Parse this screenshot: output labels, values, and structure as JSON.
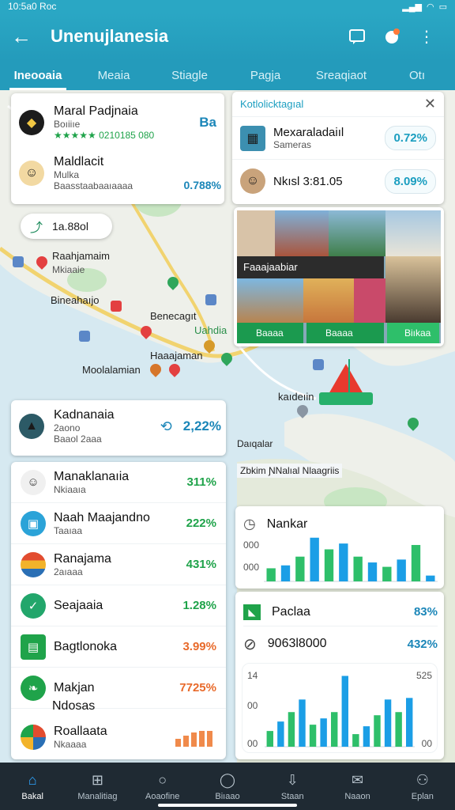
{
  "status": {
    "time": "10:5a0 Roc",
    "icons": [
      "signal-icon",
      "wifi-icon",
      "battery-icon"
    ]
  },
  "app": {
    "title": "Unenujlanesia"
  },
  "tabs": [
    {
      "label": "Ineooaia",
      "active": true
    },
    {
      "label": "Meaia"
    },
    {
      "label": "Stiagle"
    },
    {
      "label": "Pagja"
    },
    {
      "label": "Sreaqiaot"
    },
    {
      "label": "Otı"
    }
  ],
  "map_labels": {
    "a": "Raahjamaim",
    "b": "Mkiaaie",
    "c": "Bineahaıjo",
    "d": "Benecagıt",
    "e": "Uahdia",
    "f": "Haaajaman",
    "g": "Moolalamian",
    "h": "kaıdeıin",
    "i": "Daıqalar",
    "j": "Zbkim ƝNalıal Nlaagriis"
  },
  "top_card": {
    "name1": "Maral Padjnaia",
    "sub1": "Boıiiıe",
    "rating": "★★★★★ 0210185 080",
    "badge1": "Ba",
    "name2": "Maldlacit",
    "sub2": "Mulka",
    "sub2b": "Baasstaabaaıaaaa",
    "pct2": "0.788%"
  },
  "small_pill": {
    "label": "1a.88ol"
  },
  "right_card": {
    "header": "Kotlolicktagıal",
    "rows": [
      {
        "title": "Mexaraladaiıl",
        "sub": "Sameras",
        "value": "0.72%"
      },
      {
        "title": "Nkısl 3:81.05",
        "sub": "",
        "value": "8.09%"
      }
    ]
  },
  "gallery": {
    "label": "Faaajaabiar",
    "tiles": [
      "Baaaa",
      "Baaaa",
      "Biıkaa"
    ]
  },
  "mid_card": {
    "name": "Kadnanaia",
    "sub": "2aono",
    "sub2": "Baaol 2aaa",
    "value": "2,22%"
  },
  "list": [
    {
      "title": "Manaklanaıia",
      "sub": "Nkiaaıa",
      "value": "311%",
      "color": "green",
      "icon": "person-icon"
    },
    {
      "title": "Naah Maajandno",
      "sub": "Taaıaa",
      "value": "222%",
      "color": "green",
      "icon": "cube-icon"
    },
    {
      "title": "Ranajama",
      "sub": "2aıaaa",
      "value": "431%",
      "color": "green",
      "icon": "flag-icon"
    },
    {
      "title": "Seajaaia",
      "sub": "",
      "value": "1.28%",
      "color": "green",
      "icon": "leaf-icon"
    },
    {
      "title": "Bagtlonoka",
      "sub": "",
      "value": "3.99%",
      "color": "orange",
      "icon": "shop-icon"
    },
    {
      "title": "Makjan",
      "sub": "",
      "value": "7725%",
      "color": "orange",
      "icon": "leaf2-icon"
    },
    {
      "title": "Ndosas",
      "sub": "",
      "value": "",
      "color": "green",
      "icon": ""
    },
    {
      "title": "Roallaata",
      "sub": "Nkaaaa",
      "value": "",
      "color": "orange",
      "icon": "badge-icon"
    }
  ],
  "chart1": {
    "title": "Nankar",
    "yticks": [
      "000",
      "000"
    ]
  },
  "chart2": {
    "row1": {
      "title": "Paclaa",
      "value": "83%"
    },
    "row2": {
      "title": "9063l8000",
      "value": "432%"
    },
    "yticks_left": [
      "14",
      "00",
      "00"
    ],
    "yticks_right": [
      "525",
      "00"
    ]
  },
  "chart_data": [
    {
      "type": "bar",
      "title": "Nankar",
      "categories": [
        "1",
        "2",
        "3",
        "4",
        "5",
        "6",
        "7",
        "8",
        "9",
        "10",
        "11",
        "12"
      ],
      "series": [
        {
          "values": [
            18,
            22,
            34,
            60,
            44,
            52,
            34,
            26,
            20,
            30,
            50,
            8
          ]
        }
      ],
      "colors": [
        "#2ebf6a",
        "#1b9ee6"
      ]
    },
    {
      "type": "bar",
      "categories": [
        "1",
        "2",
        "3",
        "4",
        "5",
        "6",
        "7",
        "8",
        "9",
        "10",
        "11",
        "12",
        "13",
        "14"
      ],
      "series": [
        {
          "values": [
            20,
            32,
            44,
            60,
            28,
            36,
            44,
            90,
            16,
            26,
            40,
            60,
            44,
            62
          ]
        }
      ],
      "colors": [
        "#2ebf6a",
        "#1b9ee6"
      ]
    }
  ],
  "bottom_nav": [
    {
      "label": "Bakal",
      "icon": "home-icon",
      "active": true
    },
    {
      "label": "Manalitiag",
      "icon": "grid-icon"
    },
    {
      "label": "Aoaofine",
      "icon": "search-icon"
    },
    {
      "label": "Biıaao",
      "icon": "bell-icon"
    },
    {
      "label": "Staan",
      "icon": "download-icon"
    },
    {
      "label": "Naaon",
      "icon": "mail-icon"
    },
    {
      "label": "Eplan",
      "icon": "person-icon"
    }
  ]
}
